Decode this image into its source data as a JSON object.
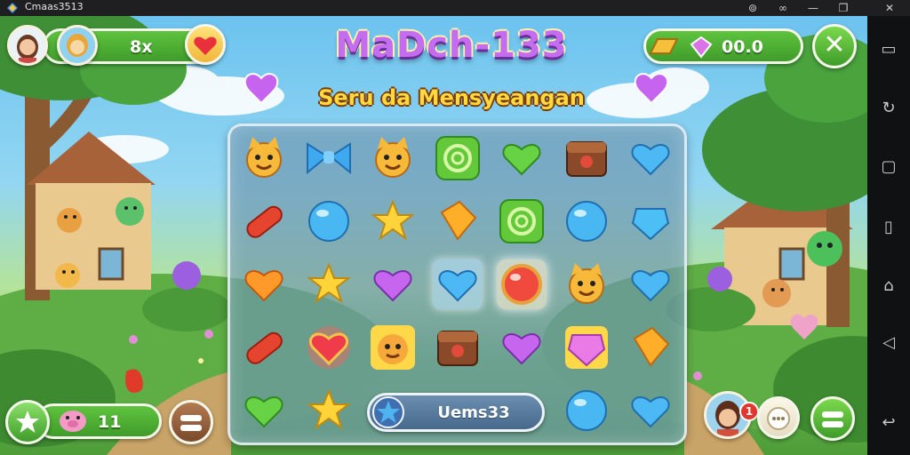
{
  "window": {
    "title": "Cmaas3513",
    "controls": [
      "settings-icon",
      "gamepad-icon",
      "minimize-icon",
      "restore-icon",
      "close-icon"
    ]
  },
  "sidebar": {
    "buttons": [
      "keyboard-icon",
      "rotate-icon",
      "screenshot-icon",
      "recent-apps-icon",
      "home-icon",
      "back-icon",
      "return-icon"
    ]
  },
  "game": {
    "title": "MaDch-133",
    "subtitle": "Seru da Mensyeangan",
    "player": {
      "score_label": "8x",
      "lives_icon": "heart-icon"
    },
    "currency": {
      "value": "00.0",
      "icons": [
        "gold-bar-icon",
        "gem-icon"
      ]
    },
    "close_button_icon": "close-icon",
    "pet_counter": {
      "value": "11",
      "icons": [
        "star-burst-icon",
        "pig-pet-icon"
      ]
    },
    "bottom_bar": {
      "label": "Uems33",
      "icon": "star-icon"
    },
    "notification_count": "1",
    "colors": {
      "hud_green": "#4fb336",
      "title_purple": "#c46df1",
      "subtitle_gold": "#ffd93f",
      "board_blue": "#6e96af"
    }
  },
  "board": {
    "rows": [
      [
        "cat-face",
        "blue-bowtie",
        "cat-face",
        "green-swirl",
        "green-heart",
        "brown-chest",
        "blue-heart"
      ],
      [
        "red-jellybean",
        "blue-orb",
        "yellow-star",
        "orange-gem",
        "green-swirl",
        "blue-orb",
        "blue-gem"
      ],
      [
        "orange-heart",
        "yellow-star",
        "purple-heart",
        "blue-heart",
        "red-orb",
        "cat-face",
        "blue-heart"
      ],
      [
        "red-jellybean",
        "red-heart-gem",
        "yellow-cat",
        "brown-chest",
        "purple-heart",
        "pink-square-gem",
        "orange-gem"
      ],
      [
        "green-heart",
        "yellow-star",
        "",
        "",
        "",
        "blue-orb",
        "blue-heart"
      ]
    ]
  }
}
